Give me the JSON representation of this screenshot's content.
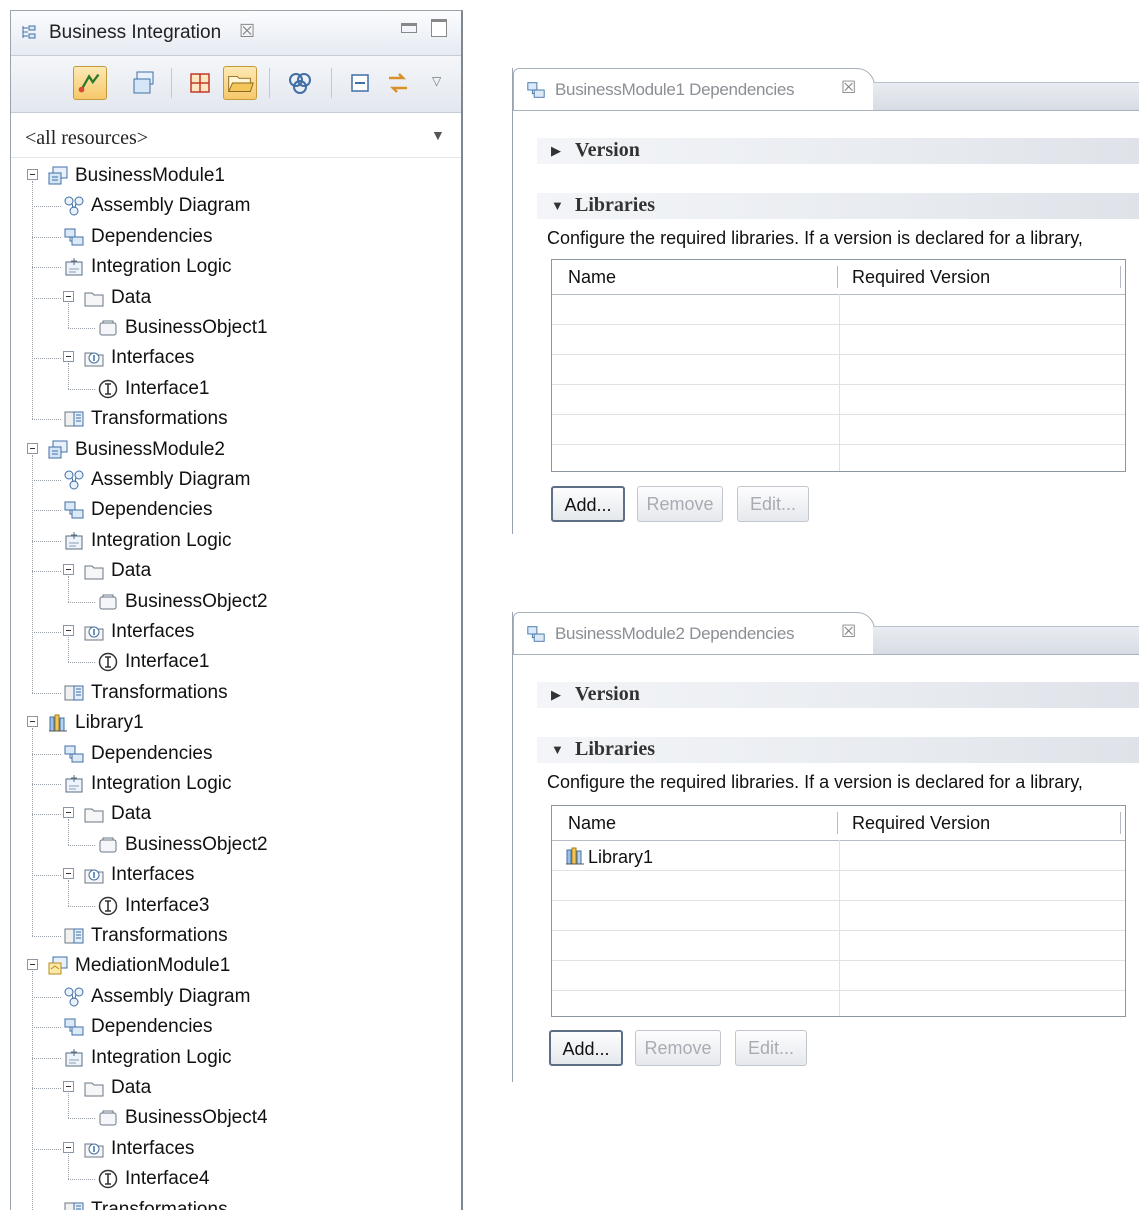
{
  "explorer": {
    "title": "Business Integration",
    "close_glyph": "☒",
    "filter": "<all resources>",
    "toolbar_icons": [
      "link-editor-icon",
      "show-categories-icon",
      "grid-icon",
      "open-folder-icon",
      "circles-icon",
      "collapse-icon",
      "sync-icon"
    ]
  },
  "tree": [
    {
      "label": "BusinessModule1",
      "level": 0,
      "expanded": true,
      "icon": "module-icon"
    },
    {
      "label": "Assembly Diagram",
      "level": 1,
      "icon": "assembly-diagram-icon"
    },
    {
      "label": "Dependencies",
      "level": 1,
      "icon": "dependencies-icon"
    },
    {
      "label": "Integration Logic",
      "level": 1,
      "icon": "integration-logic-icon"
    },
    {
      "label": "Data",
      "level": 1,
      "expanded": true,
      "icon": "data-folder-icon"
    },
    {
      "label": "BusinessObject1",
      "level": 2,
      "icon": "business-object-icon"
    },
    {
      "label": "Interfaces",
      "level": 1,
      "expanded": true,
      "icon": "interfaces-folder-icon"
    },
    {
      "label": "Interface1",
      "level": 2,
      "icon": "interface-icon"
    },
    {
      "label": "Transformations",
      "level": 1,
      "icon": "transformations-icon"
    },
    {
      "label": "BusinessModule2",
      "level": 0,
      "expanded": true,
      "icon": "module-icon"
    },
    {
      "label": "Assembly Diagram",
      "level": 1,
      "icon": "assembly-diagram-icon"
    },
    {
      "label": "Dependencies",
      "level": 1,
      "icon": "dependencies-icon"
    },
    {
      "label": "Integration Logic",
      "level": 1,
      "icon": "integration-logic-icon"
    },
    {
      "label": "Data",
      "level": 1,
      "expanded": true,
      "icon": "data-folder-icon"
    },
    {
      "label": "BusinessObject2",
      "level": 2,
      "icon": "business-object-icon"
    },
    {
      "label": "Interfaces",
      "level": 1,
      "expanded": true,
      "icon": "interfaces-folder-icon"
    },
    {
      "label": "Interface1",
      "level": 2,
      "icon": "interface-icon"
    },
    {
      "label": "Transformations",
      "level": 1,
      "icon": "transformations-icon"
    },
    {
      "label": "Library1",
      "level": 0,
      "expanded": true,
      "icon": "library-icon"
    },
    {
      "label": "Dependencies",
      "level": 1,
      "icon": "dependencies-icon"
    },
    {
      "label": "Integration Logic",
      "level": 1,
      "icon": "integration-logic-icon"
    },
    {
      "label": "Data",
      "level": 1,
      "expanded": true,
      "icon": "data-folder-icon"
    },
    {
      "label": "BusinessObject2",
      "level": 2,
      "icon": "business-object-icon"
    },
    {
      "label": "Interfaces",
      "level": 1,
      "expanded": true,
      "icon": "interfaces-folder-icon"
    },
    {
      "label": "Interface3",
      "level": 2,
      "icon": "interface-icon"
    },
    {
      "label": "Transformations",
      "level": 1,
      "icon": "transformations-icon"
    },
    {
      "label": "MediationModule1",
      "level": 0,
      "expanded": true,
      "icon": "mediation-module-icon"
    },
    {
      "label": "Assembly Diagram",
      "level": 1,
      "icon": "assembly-diagram-icon"
    },
    {
      "label": "Dependencies",
      "level": 1,
      "icon": "dependencies-icon"
    },
    {
      "label": "Integration Logic",
      "level": 1,
      "icon": "integration-logic-icon"
    },
    {
      "label": "Data",
      "level": 1,
      "expanded": true,
      "icon": "data-folder-icon"
    },
    {
      "label": "BusinessObject4",
      "level": 2,
      "icon": "business-object-icon"
    },
    {
      "label": "Interfaces",
      "level": 1,
      "expanded": true,
      "icon": "interfaces-folder-icon"
    },
    {
      "label": "Interface4",
      "level": 2,
      "icon": "interface-icon"
    },
    {
      "label": "Transformations",
      "level": 1,
      "icon": "transformations-icon"
    }
  ],
  "editor1": {
    "tab_title": "BusinessModule1 Dependencies",
    "close_glyph": "☒",
    "version_label": "Version",
    "libraries_label": "Libraries",
    "description": "Configure the required libraries.  If a version is declared for a library,",
    "columns": [
      "Name",
      "Required Version"
    ],
    "rows": [],
    "buttons": {
      "add": "Add...",
      "remove": "Remove",
      "edit": "Edit..."
    }
  },
  "editor2": {
    "tab_title": "BusinessModule2 Dependencies",
    "close_glyph": "☒",
    "version_label": "Version",
    "libraries_label": "Libraries",
    "description": "Configure the required libraries.  If a version is declared for a library,",
    "columns": [
      "Name",
      "Required Version"
    ],
    "rows": [
      {
        "name": "Library1",
        "required_version": "",
        "icon": "library-icon"
      }
    ],
    "buttons": {
      "add": "Add...",
      "remove": "Remove",
      "edit": "Edit..."
    }
  },
  "colors": {
    "accent": "#f6c96a",
    "border": "#8c96a2",
    "disabled_text": "#a8acb2"
  }
}
